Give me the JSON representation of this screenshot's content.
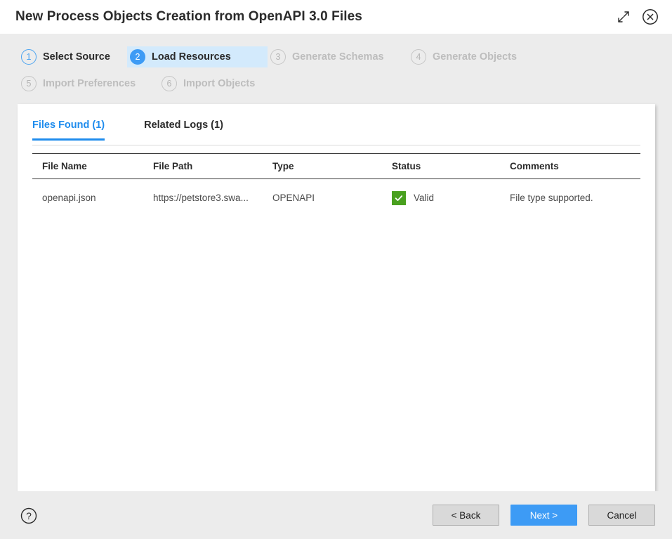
{
  "window": {
    "title": "New Process Objects Creation from OpenAPI 3.0 Files",
    "expand_icon": "expand-diagonal-icon",
    "close_icon": "close-circle-icon",
    "accent_color": "#3d9bf5",
    "background_color": "#ececec"
  },
  "stepper": {
    "steps": [
      {
        "number": "1",
        "label": "Select Source",
        "state": "done"
      },
      {
        "number": "2",
        "label": "Load Resources",
        "state": "active"
      },
      {
        "number": "3",
        "label": "Generate Schemas",
        "state": "todo"
      },
      {
        "number": "4",
        "label": "Generate Objects",
        "state": "todo"
      },
      {
        "number": "5",
        "label": "Import Preferences",
        "state": "todo"
      },
      {
        "number": "6",
        "label": "Import Objects",
        "state": "todo"
      }
    ],
    "active_highlight_color": "#d3eafc"
  },
  "panel": {
    "tabs": [
      {
        "label": "Files Found (1)",
        "selected": true
      },
      {
        "label": "Related Logs (1)",
        "selected": false
      }
    ],
    "tab_active_color": "#1f8ced",
    "table": {
      "columns": [
        "File Name",
        "File Path",
        "Type",
        "Status",
        "Comments"
      ],
      "rows": [
        {
          "file_name": "openapi.json",
          "file_path": "https://petstore3.swa...",
          "type": "OPENAPI",
          "status": "Valid",
          "status_icon": "check-icon",
          "status_color": "#49a01f",
          "comments": "File type supported."
        }
      ]
    }
  },
  "footer": {
    "help_icon": "help-circle-icon",
    "buttons": [
      {
        "label": "< Back",
        "style": "secondary"
      },
      {
        "label": "Next >",
        "style": "primary"
      },
      {
        "label": "Cancel",
        "style": "secondary"
      }
    ]
  }
}
